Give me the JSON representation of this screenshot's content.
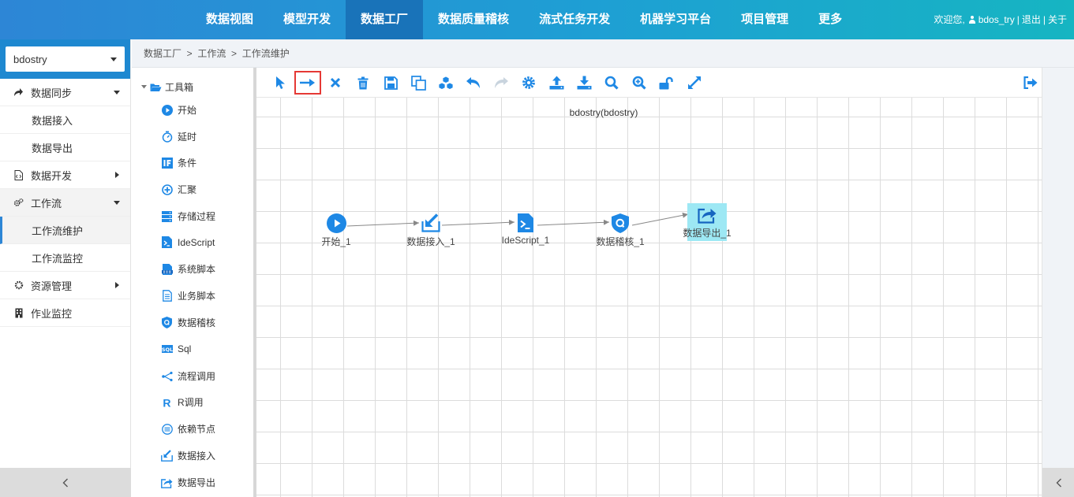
{
  "colors": {
    "brand": "#2d86d6",
    "header_gradient_end": "#16b5c2",
    "nav_active": "#1973b9",
    "icon_blue": "#1e88e5",
    "selected_outline": "#e53935",
    "highlight": "#9de8f4"
  },
  "header": {
    "nav": [
      "数据视图",
      "模型开发",
      "数据工厂",
      "数据质量稽核",
      "流式任务开发",
      "机器学习平台",
      "项目管理",
      "更多"
    ],
    "active_nav": "数据工厂",
    "welcome": "欢迎您,",
    "username": "bdos_try",
    "sep1": "|",
    "logout": "退出",
    "sep2": "|",
    "about": "关于"
  },
  "sidebar": {
    "project": "bdostry",
    "menu": [
      {
        "label": "数据同步",
        "icon": "share-arrow-icon"
      },
      {
        "label": "数据接入"
      },
      {
        "label": "数据导出"
      },
      {
        "label": "数据开发",
        "icon": "code-file-icon"
      },
      {
        "label": "工作流",
        "icon": "gears-icon"
      },
      {
        "label": "工作流维护"
      },
      {
        "label": "工作流监控"
      },
      {
        "label": "资源管理",
        "icon": "gear-icon"
      },
      {
        "label": "作业监控",
        "icon": "building-icon"
      }
    ],
    "collapse": "‹"
  },
  "breadcrumb": "数据工厂  >  工作流  >  工作流维护",
  "toolbox": {
    "title": "工具箱",
    "items": [
      "开始",
      "延时",
      "条件",
      "汇聚",
      "存储过程",
      "IdeScript",
      "系统脚本",
      "业务脚本",
      "数据稽核",
      "Sql",
      "流程调用",
      "R调用",
      "依赖节点",
      "数据接入",
      "数据导出"
    ]
  },
  "canvas": {
    "title": "bdostry(bdostry)",
    "toolbar": [
      "pointer-icon",
      "connect-arrow-icon",
      "delete-x-icon",
      "trash-icon",
      "save-icon",
      "copy-icon",
      "cubes-icon",
      "undo-icon",
      "redo-icon",
      "settings-gear-icon",
      "upload-icon",
      "download-icon",
      "search-icon",
      "zoom-in-icon",
      "unlock-icon",
      "fullscreen-icon"
    ],
    "selected_tool": "connect-arrow-icon",
    "exit_icon": "exit-icon",
    "nodes": [
      {
        "label": "开始_1",
        "icon": "play-circle-icon"
      },
      {
        "label": "数据接入_1",
        "icon": "data-import-icon"
      },
      {
        "label": "IdeScript_1",
        "icon": "idescript-icon"
      },
      {
        "label": "数据稽核_1",
        "icon": "audit-shield-icon"
      },
      {
        "label": "数据导出_1",
        "icon": "data-export-icon",
        "highlighted": true
      }
    ]
  },
  "right_collapse": "‹"
}
